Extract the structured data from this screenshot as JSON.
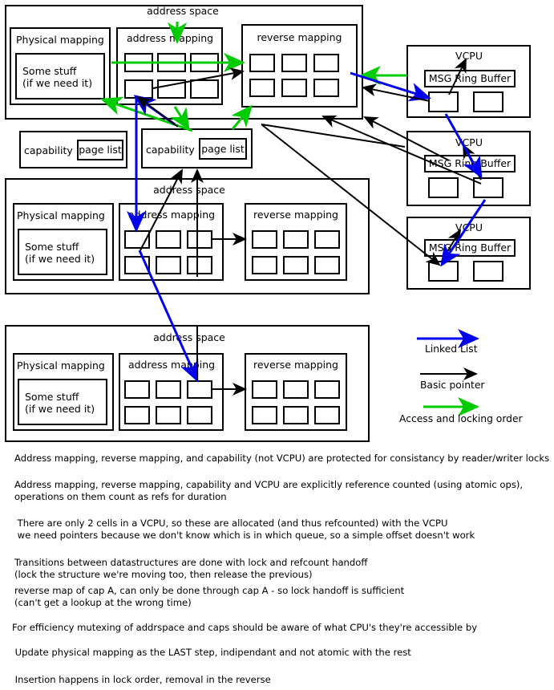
{
  "diagram": {
    "title_labels": {
      "address_space": "address space",
      "physical_mapping": "Physical mapping",
      "some_stuff": "Some stuff\n(if we need it)",
      "address_mapping": "address mapping",
      "reverse_mapping": "reverse mapping",
      "capability": "capability",
      "page_list": "page list",
      "vcpu": "VCPU",
      "msg_ring_buffer": "MSG Ring Buffer"
    },
    "address_spaces": [
      {
        "id": "address-space-1",
        "label": "address space",
        "physical_mapping": "Physical mapping",
        "inner_text": "Some stuff\n(if we need it)",
        "address_mapping": "address mapping",
        "reverse_mapping": "reverse mapping",
        "address_mapping_cells": 6,
        "reverse_mapping_cells": 6
      },
      {
        "id": "address-space-2",
        "label": "address space",
        "physical_mapping": "Physical mapping",
        "inner_text": "Some stuff\n(if we need it)",
        "address_mapping": "address mapping",
        "reverse_mapping": "reverse mapping",
        "address_mapping_cells": 6,
        "reverse_mapping_cells": 6
      },
      {
        "id": "address-space-3",
        "label": "address space",
        "physical_mapping": "Physical mapping",
        "inner_text": "Some stuff\n(if we need it)",
        "address_mapping": "address mapping",
        "reverse_mapping": "reverse mapping",
        "address_mapping_cells": 6,
        "reverse_mapping_cells": 6
      }
    ],
    "capabilities": [
      {
        "id": "capability-left",
        "label": "capability",
        "page_list": "page list"
      },
      {
        "id": "capability-right",
        "label": "capability",
        "page_list": "page list"
      }
    ],
    "vcpus": [
      {
        "id": "vcpu-1",
        "label": "VCPU",
        "ring_buffer": "MSG Ring Buffer",
        "cells": 2
      },
      {
        "id": "vcpu-2",
        "label": "VCPU",
        "ring_buffer": "MSG Ring Buffer",
        "cells": 2
      },
      {
        "id": "vcpu-3",
        "label": "VCPU",
        "ring_buffer": "MSG Ring Buffer",
        "cells": 2
      }
    ],
    "legend": {
      "items": [
        {
          "id": "legend-linked-list",
          "label": "Linked List",
          "color": "#0000ee"
        },
        {
          "id": "legend-basic-pointer",
          "label": "Basic pointer",
          "color": "#000000"
        },
        {
          "id": "legend-access-locking-order",
          "label": "Access and locking order",
          "color": "#00cc00"
        }
      ]
    },
    "notes": [
      "Address mapping, reverse mapping, and capability (not VCPU) are protected for consistancy by reader/writer locks",
      "Address mapping, reverse mapping, capability and VCPU are explicitly reference counted (using atomic ops),\noperations on them count as refs for duration",
      " There are only 2 cells in a VCPU, so these are allocated (and thus refcounted) with the VCPU\n we need pointers because we don't know which is in which queue, so a simple offset doesn't work",
      "Transitions between datastructures are done with lock and refcount handoff\n(lock the structure we're moving too, then release the previous)",
      "reverse map of cap A, can only be done through cap A - so lock handoff is sufficient\n(can't get a lookup at the wrong time)",
      "For efficiency mutexing of addrspace and caps should be aware of what CPU's they're accessible by",
      " Update physical mapping as the LAST step, indipendant and not atomic with the rest",
      " Insertion happens in lock order, removal in the reverse"
    ],
    "colors": {
      "linked_list": "#0000ee",
      "basic_pointer": "#000000",
      "access_order": "#00cc00",
      "outline": "#000000",
      "background": "#ffffff"
    }
  }
}
